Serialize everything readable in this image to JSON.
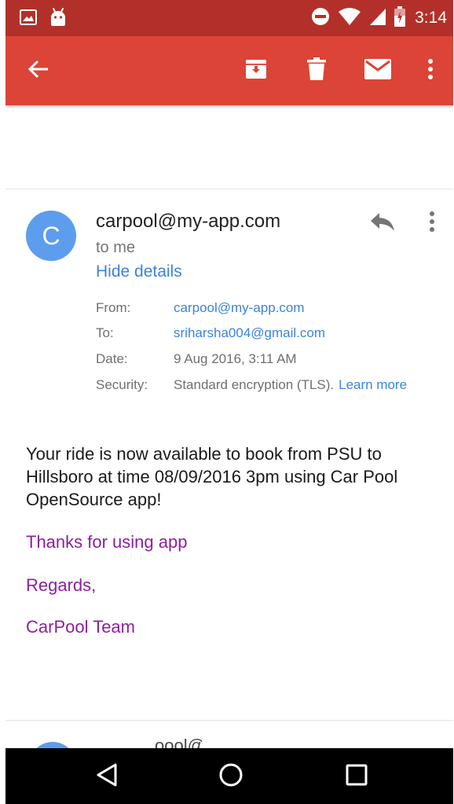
{
  "colors": {
    "status_bar": "#b3302a",
    "toolbar": "#db4437",
    "avatar": "#5c9ded",
    "link": "#3b82e0",
    "signature": "#8e1f9c"
  },
  "status_bar": {
    "left_icons": [
      "image-icon",
      "android-icon"
    ],
    "right_icons": [
      "do-not-disturb-icon",
      "wifi-icon",
      "cell-signal-icon",
      "battery-icon"
    ],
    "time": "3:14"
  },
  "toolbar": {
    "icons": [
      "back-arrow-icon",
      "archive-icon",
      "delete-icon",
      "mail-icon",
      "more-vert-icon"
    ]
  },
  "message": {
    "avatar_letter": "C",
    "sender": "carpool@my-app.com",
    "recipient_summary": "to me",
    "hide_details": "Hide details",
    "details": {
      "from_label": "From:",
      "from_value": "carpool@my-app.com",
      "to_label": "To:",
      "to_value": "sriharsha004@gmail.com",
      "date_label": "Date:",
      "date_value": "9 Aug 2016, 3:11 AM",
      "security_label": "Security:",
      "security_value": "Standard encryption (TLS).",
      "learn_more": "Learn more"
    },
    "body": "Your ride is now available to book from PSU to Hillsboro at time 08/09/2016 3pm using Car Pool OpenSource app!",
    "thanks": "Thanks for using app",
    "regards": "Regards,",
    "signature": "CarPool Team"
  },
  "next_message_peek": {
    "sender_fragment": "oool@"
  },
  "nav_bar": {
    "icons": [
      "back-triangle-icon",
      "home-circle-icon",
      "recents-square-icon"
    ]
  }
}
